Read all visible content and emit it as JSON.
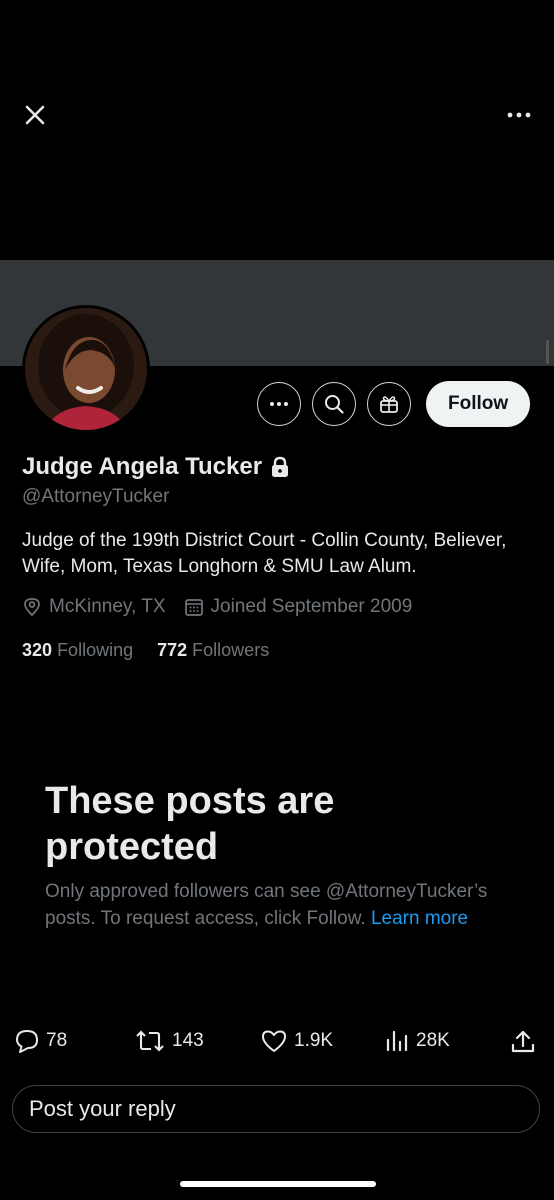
{
  "profile": {
    "display_name": "Judge Angela Tucker",
    "handle": "@AttorneyTucker",
    "bio": "Judge of the 199th District Court - Collin County, Believer, Wife, Mom, Texas Longhorn & SMU Law Alum.",
    "location": "McKinney, TX",
    "joined": "Joined September 2009",
    "following_count": "320",
    "following_label": "Following",
    "followers_count": "772",
    "followers_label": "Followers"
  },
  "actions": {
    "follow_label": "Follow"
  },
  "protected": {
    "title": "These posts are protected",
    "description": "Only approved followers can see @AttorneyTucker’s posts. To request access, click Follow.",
    "learn_more": "Learn more"
  },
  "engagement": {
    "replies": "78",
    "reposts": "143",
    "likes": "1.9K",
    "views": "28K"
  },
  "reply": {
    "placeholder": "Post your reply"
  },
  "icons": [
    "close-icon",
    "more-icon",
    "search-icon",
    "gift-icon",
    "lock-icon",
    "location-icon",
    "calendar-icon",
    "reply-icon",
    "repost-icon",
    "like-icon",
    "views-icon",
    "share-icon"
  ],
  "colors": {
    "background": "#000000",
    "banner": "#333639",
    "text_primary": "#e7e9ea",
    "text_secondary": "#71767b",
    "link": "#1d9bf0",
    "follow_button_bg": "#eff3f4"
  }
}
